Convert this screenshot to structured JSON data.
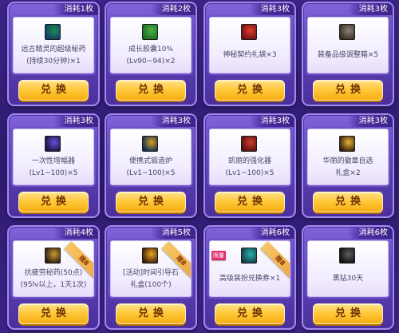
{
  "exchange_label": "兑换",
  "items": [
    {
      "cost": "消耗1枚",
      "lines": [
        "远古精灵的超级秘药",
        "(持续30分钟)×1"
      ],
      "icon": "ancient-potion-icon",
      "colors": [
        "#0d3b6e",
        "#1e8d4d"
      ]
    },
    {
      "cost": "消耗2枚",
      "lines": [
        "成长胶囊10%",
        "(Lv90~94)×2"
      ],
      "icon": "growth-capsule-icon",
      "colors": [
        "#1f6b24",
        "#4bb446"
      ]
    },
    {
      "cost": "消耗3枚",
      "lines": [
        "神秘契约礼袋×3"
      ],
      "icon": "mystery-bag-icon",
      "colors": [
        "#6a1212",
        "#e13d2a"
      ]
    },
    {
      "cost": "消耗3枚",
      "lines": [
        "装备品级调整箱×5"
      ],
      "icon": "equipment-box-icon",
      "colors": [
        "#3a2e22",
        "#8c8178"
      ]
    },
    {
      "cost": "消耗3枚",
      "lines": [
        "一次性增幅器",
        "(Lv1~100)×5"
      ],
      "icon": "amplifier-icon",
      "colors": [
        "#151541",
        "#6a4fd8"
      ]
    },
    {
      "cost": "消耗3枚",
      "lines": [
        "便携式锻造炉",
        "(Lv1~100)×5"
      ],
      "icon": "portable-forge-icon",
      "colors": [
        "#0b2b5a",
        "#d7a21c"
      ]
    },
    {
      "cost": "消耗3枚",
      "lines": [
        "凯丽的强化器",
        "(Lv1~100)×5"
      ],
      "icon": "enhancer-icon",
      "colors": [
        "#541010",
        "#d43c2d"
      ]
    },
    {
      "cost": "消耗3枚",
      "lines": [
        "华丽的徽章自选",
        "礼盒×2"
      ],
      "icon": "emblem-box-icon",
      "colors": [
        "#3a1c0c",
        "#e2b432"
      ]
    },
    {
      "cost": "消耗4枚",
      "lines": [
        "抗疲劳秘药(50点)",
        "(95lv以上，1天1次)"
      ],
      "icon": "fatigue-potion-icon",
      "colors": [
        "#2a1d10",
        "#c89a2e"
      ],
      "ribbon": "限8"
    },
    {
      "cost": "消耗5枚",
      "lines": [
        "[活动]时间引导石",
        "礼盒(100个)"
      ],
      "icon": "time-stone-icon",
      "colors": [
        "#3b1c0b",
        "#e9aa24"
      ],
      "ribbon": "限8"
    },
    {
      "cost": "消耗6枚",
      "lines": [
        "高级装扮兑换券×1"
      ],
      "icon": "avatar-ticket-icon",
      "colors": [
        "#0f3e44",
        "#2db0a8"
      ],
      "ribbon": "限8",
      "tag": "限量"
    },
    {
      "cost": "消耗6枚",
      "lines": [
        "黑钻30天"
      ],
      "icon": "black-diamond-icon",
      "colors": [
        "#111111",
        "#5d5d5d"
      ]
    }
  ]
}
